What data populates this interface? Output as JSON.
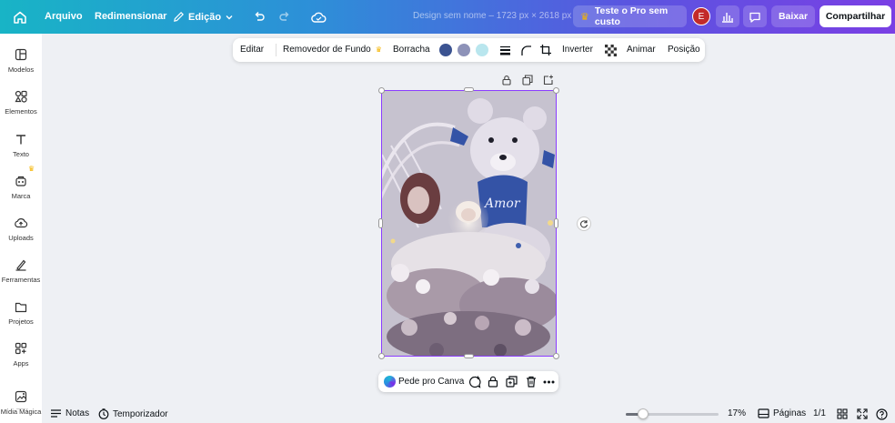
{
  "topbar": {
    "menu": [
      "Arquivo",
      "Redimensionar",
      "Edição"
    ],
    "design_title": "Design sem nome – 1723 px × 2618 px",
    "pro_label": "Teste o Pro sem custo",
    "avatar_initial": "E",
    "download_label": "Baixar",
    "share_label": "Compartilhar"
  },
  "sidebar": {
    "items": [
      {
        "label": "Modelos",
        "icon": "templates-icon"
      },
      {
        "label": "Elementos",
        "icon": "elements-icon"
      },
      {
        "label": "Texto",
        "icon": "text-icon"
      },
      {
        "label": "Marca",
        "icon": "brand-icon"
      },
      {
        "label": "Uploads",
        "icon": "upload-icon"
      },
      {
        "label": "Ferramentas",
        "icon": "tools-icon"
      },
      {
        "label": "Projetos",
        "icon": "folder-icon"
      },
      {
        "label": "Apps",
        "icon": "apps-icon"
      },
      {
        "label": "Mídia Mágica",
        "icon": "magic-media-icon"
      }
    ]
  },
  "context_toolbar": {
    "edit": "Editar",
    "bg_remover": "Removedor de Fundo",
    "eraser": "Borracha",
    "swatches": [
      "#3b5391",
      "#8d92b8",
      "#b9e6ee"
    ],
    "flip": "Inverter",
    "animate": "Animar",
    "position": "Posição"
  },
  "floating_bar": {
    "ask_canva": "Pede pro Canva"
  },
  "footer": {
    "notes": "Notas",
    "timer": "Temporizador",
    "zoom_value": 17,
    "zoom": "17%",
    "pages": "Páginas",
    "page_count": "1/1"
  }
}
